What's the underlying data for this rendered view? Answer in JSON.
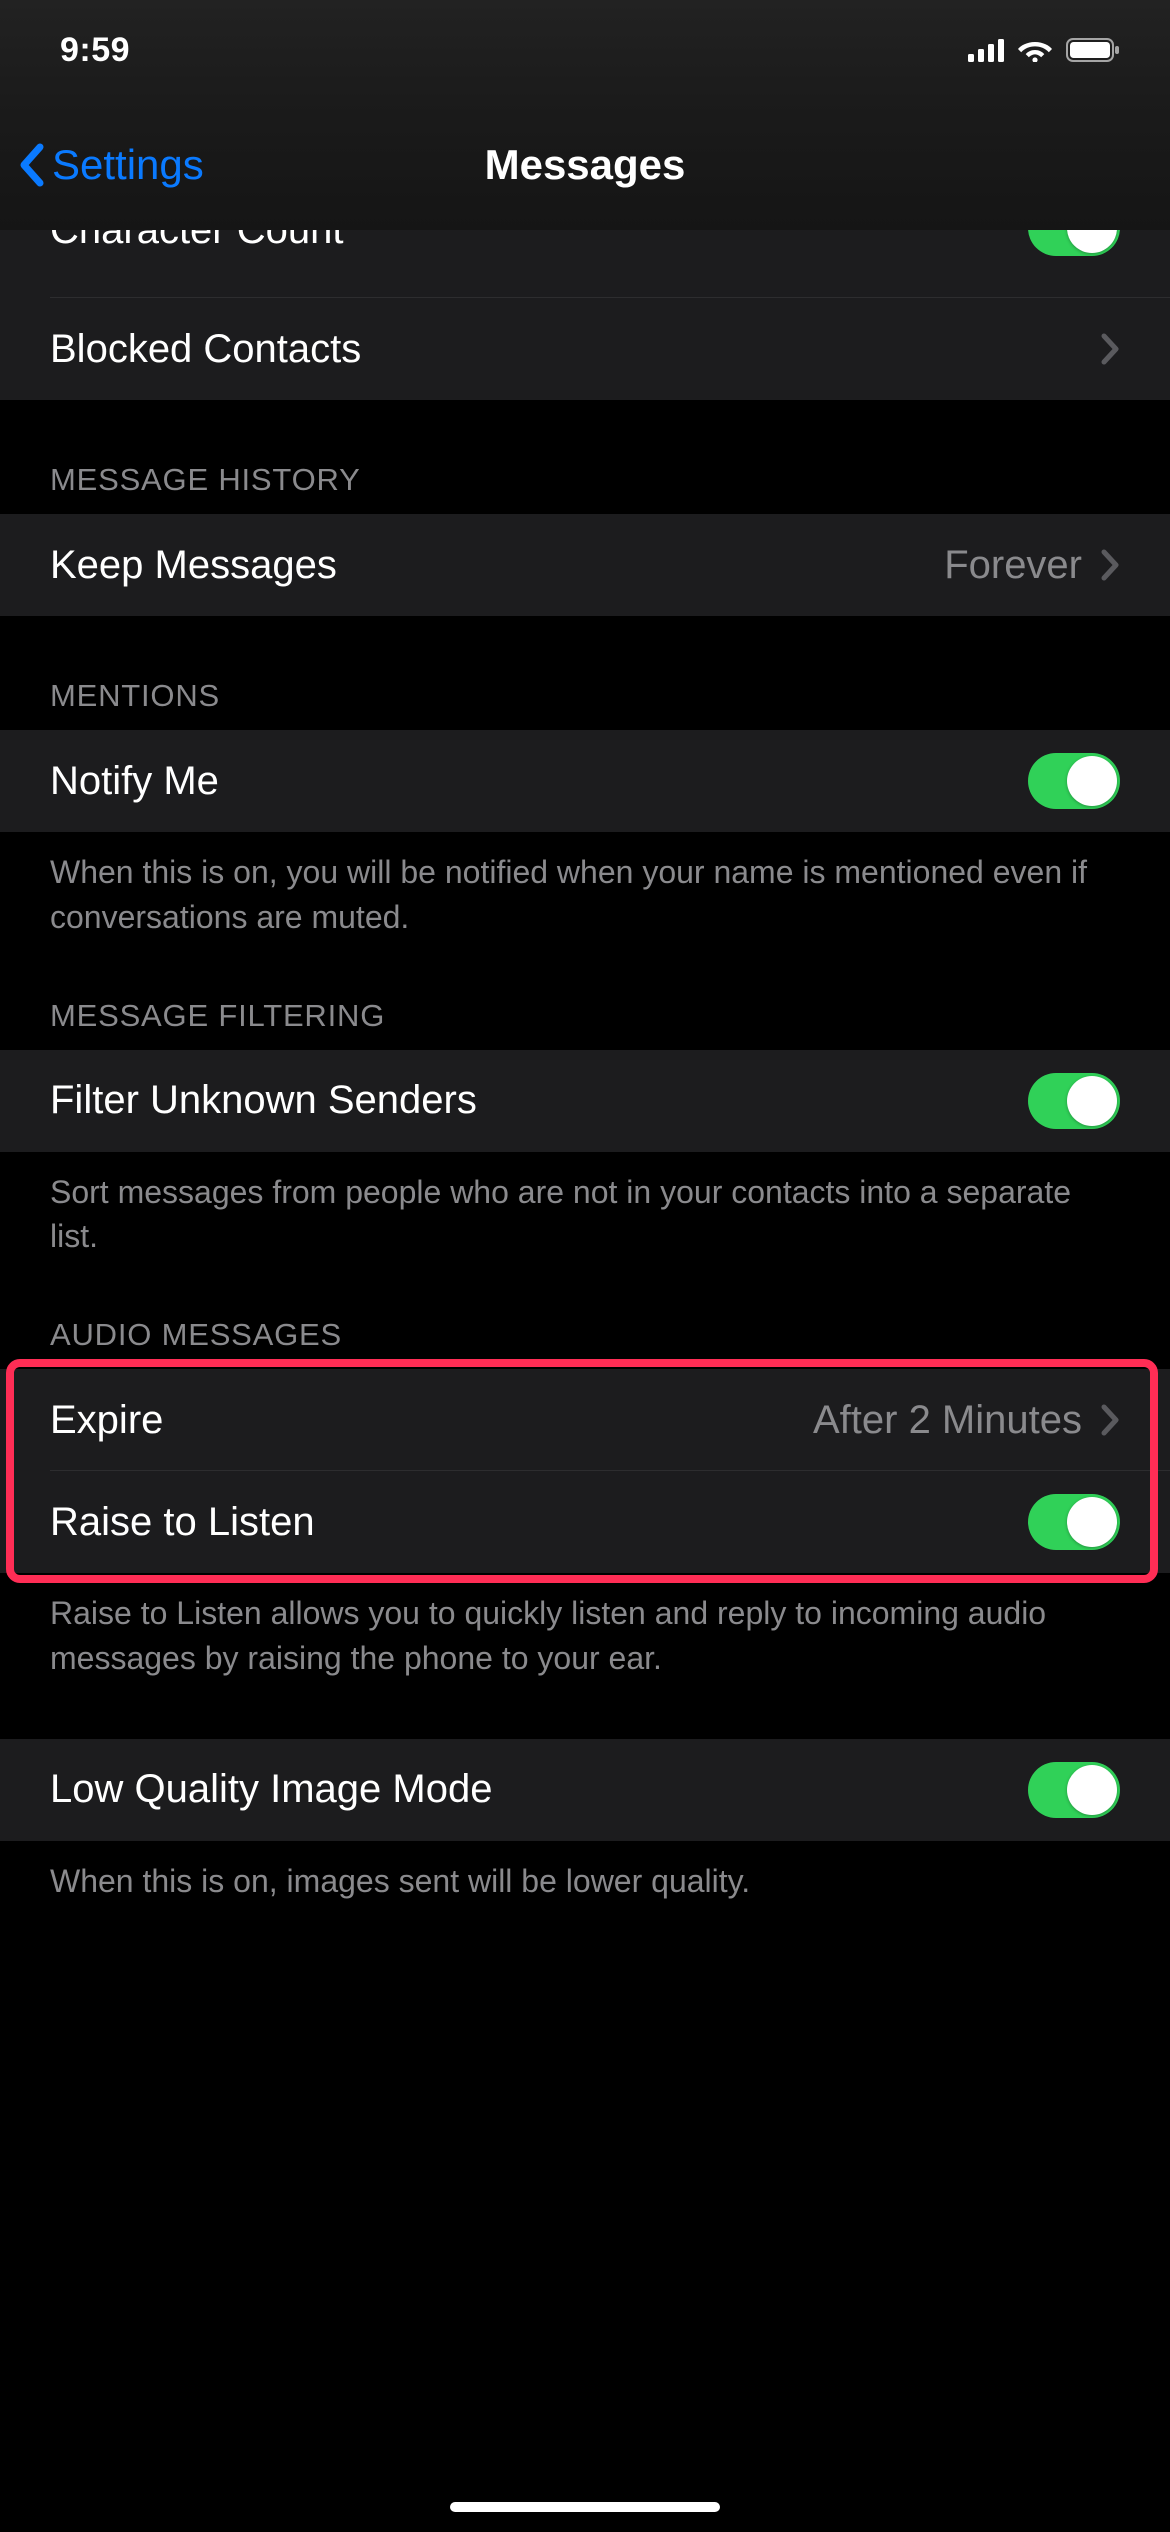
{
  "status": {
    "time": "9:59"
  },
  "nav": {
    "back_label": "Settings",
    "title": "Messages"
  },
  "rows": {
    "character_count": {
      "label": "Character Count",
      "on": true
    },
    "blocked_contacts": {
      "label": "Blocked Contacts"
    },
    "keep_messages": {
      "label": "Keep Messages",
      "value": "Forever"
    },
    "notify_me": {
      "label": "Notify Me",
      "on": true
    },
    "filter_unknown": {
      "label": "Filter Unknown Senders",
      "on": true
    },
    "expire": {
      "label": "Expire",
      "value": "After 2 Minutes"
    },
    "raise_to_listen": {
      "label": "Raise to Listen",
      "on": true
    },
    "low_quality": {
      "label": "Low Quality Image Mode",
      "on": true
    }
  },
  "sections": {
    "message_history": "MESSAGE HISTORY",
    "mentions": "MENTIONS",
    "message_filtering": "MESSAGE FILTERING",
    "audio_messages": "AUDIO MESSAGES"
  },
  "footers": {
    "notify_me": "When this is on, you will be notified when your name is mentioned even if conversations are muted.",
    "filter_unknown": "Sort messages from people who are not in your contacts into a separate list.",
    "raise_to_listen": "Raise to Listen allows you to quickly listen and reply to incoming audio messages by raising the phone to your ear.",
    "low_quality": "When this is on, images sent will be lower quality."
  }
}
